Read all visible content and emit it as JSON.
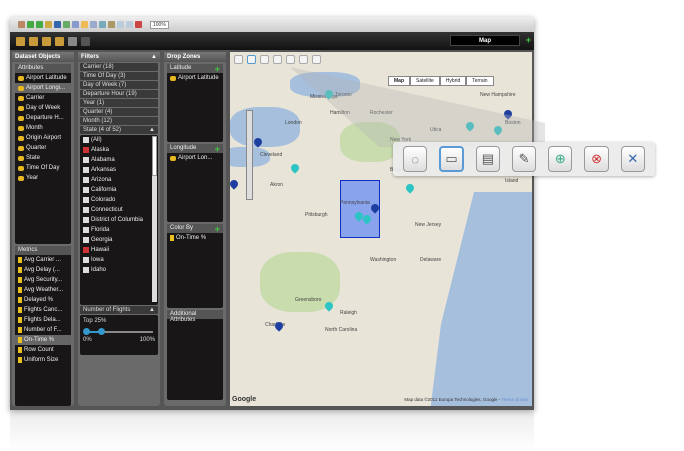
{
  "toolbar": {
    "zoom": "100%"
  },
  "view_tab": {
    "label": "Map"
  },
  "dataset": {
    "title": "Dataset Objects",
    "attributes_label": "Attributes",
    "attributes": [
      "Airport Latitude",
      "Airport Longi...",
      "Carrier",
      "Day of Week",
      "Departure H...",
      "Month",
      "Origin Airport",
      "Quarter",
      "State",
      "Time Of Day",
      "Year"
    ],
    "metrics_label": "Metrics",
    "metrics": [
      "Avg Carrier ...",
      "Avg Delay (...",
      "Avg Security...",
      "Avg Weather...",
      "Delayed %",
      "Flights Canc...",
      "Flights Dela...",
      "Number of F...",
      "On-Time %",
      "Row Count",
      "Uniform Size"
    ]
  },
  "filters": {
    "title": "Filters",
    "groups": [
      "Carrier (18)",
      "Time Of Day (3)",
      "Day of Week (7)",
      "Departure Hour (19)",
      "Year (1)",
      "Quarter (4)",
      "Month (12)"
    ],
    "state_header": "State (4 of 52)",
    "states": [
      {
        "name": "(All)",
        "x": false
      },
      {
        "name": "Alaska",
        "x": true
      },
      {
        "name": "Alabama",
        "x": false
      },
      {
        "name": "Arkansas",
        "x": false
      },
      {
        "name": "Arizona",
        "x": false
      },
      {
        "name": "California",
        "x": false
      },
      {
        "name": "Colorado",
        "x": false
      },
      {
        "name": "Connecticut",
        "x": false
      },
      {
        "name": "District of Columbia",
        "x": false
      },
      {
        "name": "Florida",
        "x": false
      },
      {
        "name": "Georgia",
        "x": false
      },
      {
        "name": "Hawaii",
        "x": true
      },
      {
        "name": "Iowa",
        "x": false
      },
      {
        "name": "Idaho",
        "x": false
      }
    ],
    "flights_header": "Number of Flights",
    "flights_value": "Top 25%",
    "slider_min": "0%",
    "slider_max": "100%",
    "slider_range": [
      0,
      25
    ]
  },
  "dropzones": {
    "title": "Drop Zones",
    "latitude": "Latitude",
    "latitude_item": "Airport Latitude",
    "longitude": "Longitude",
    "longitude_item": "Airport Lon...",
    "colorby": "Color By",
    "colorby_item": "On-Time %",
    "additional": "Additional Attributes"
  },
  "map": {
    "types": [
      "Map",
      "Satellite",
      "Hybrid",
      "Terrain"
    ],
    "cities": [
      "Toronto",
      "Rochester",
      "Mississauga",
      "London",
      "Hamilton",
      "New York",
      "Utica",
      "Albany",
      "Binghamton",
      "Pennsylvania",
      "Pittsburgh",
      "Akron",
      "Cleveland",
      "New Jersey",
      "Delaware",
      "Washington",
      "Greensboro",
      "Raleigh",
      "Charlotte",
      "North Carolina",
      "Boston",
      "Rhode Island",
      "New Hampshire"
    ],
    "google": "Google",
    "copyright": "Map data ©2011 Europa Technologies, Google -",
    "terms": "Terms of Use"
  }
}
